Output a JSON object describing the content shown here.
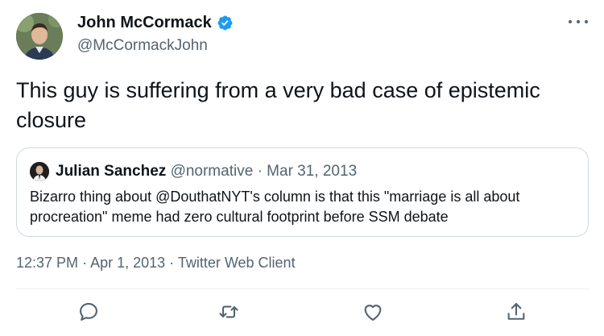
{
  "author": {
    "name": "John McCormack",
    "handle": "@McCormackJohn",
    "verified": true
  },
  "tweet": {
    "text": "This guy is suffering from a very bad case of epistemic closure"
  },
  "quoted": {
    "name": "Julian Sanchez",
    "handle": "@normative",
    "separator": "·",
    "date": "Mar 31, 2013",
    "text": "Bizarro thing about @DouthatNYT's column is that this \"marriage is all about procreation\" meme had zero cultural footprint before SSM debate"
  },
  "meta": {
    "time": "12:37 PM",
    "separator": "·",
    "date": "Apr 1, 2013",
    "client": "Twitter Web Client"
  },
  "actions": [
    "reply-icon",
    "retweet-icon",
    "like-icon",
    "share-icon"
  ],
  "colors": {
    "verified": "#1d9bf0",
    "secondary_text": "#536471",
    "border": "#cfd9de"
  }
}
